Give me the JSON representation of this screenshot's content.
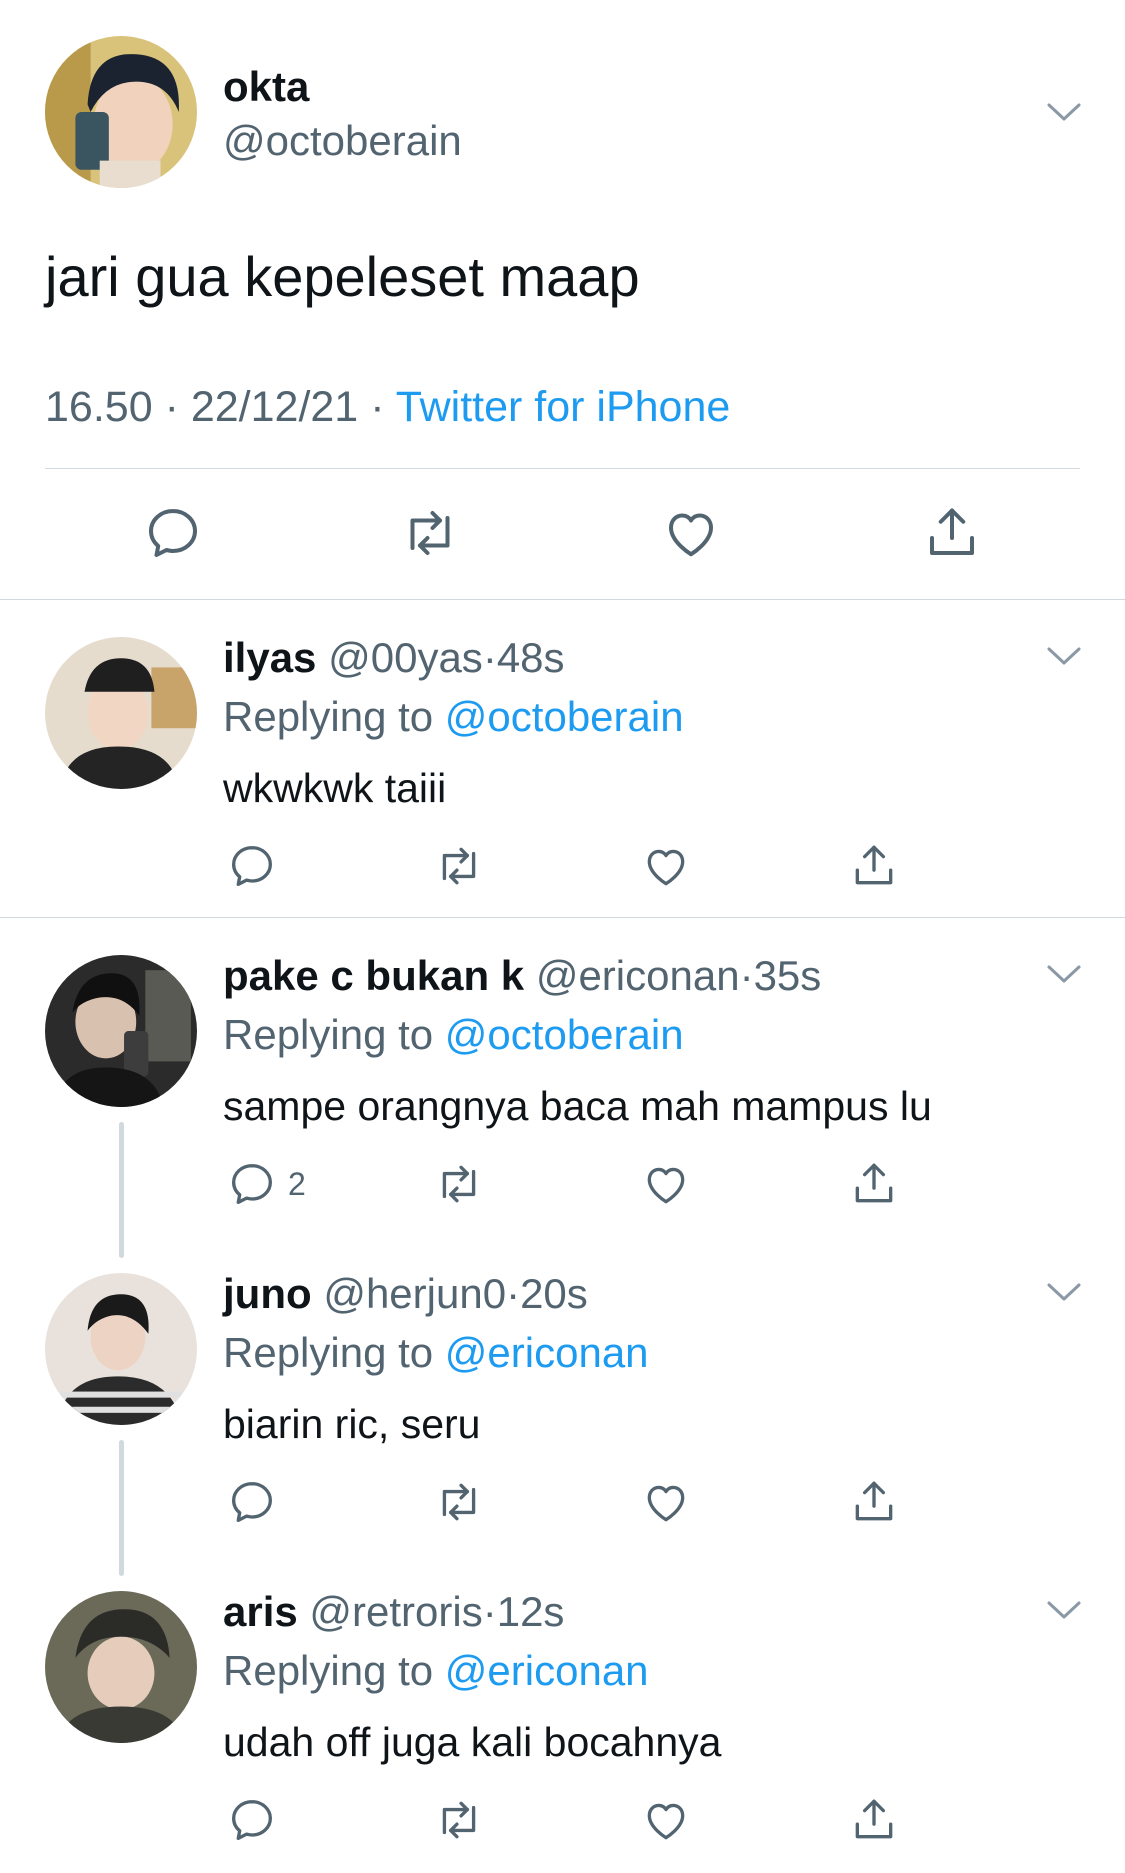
{
  "main_tweet": {
    "display_name": "okta",
    "handle": "@octoberain",
    "text": "jari gua kepeleset maap",
    "time": "16.50",
    "date": "22/12/21",
    "sep": "·",
    "source": "Twitter for iPhone"
  },
  "replies": [
    {
      "display_name": "ilyas",
      "handle": "@00yas",
      "sep": "·",
      "time": "48s",
      "replying_prefix": "Replying to",
      "replying_to": "@octoberain",
      "text": "wkwkwk taiii",
      "reply_count": ""
    },
    {
      "display_name": "pake c bukan k",
      "handle": "@ericonan",
      "sep": "·",
      "time": "35s",
      "replying_prefix": "Replying to",
      "replying_to": "@octoberain",
      "text": "sampe orangnya baca mah mampus lu",
      "reply_count": "2"
    },
    {
      "display_name": "juno",
      "handle": "@herjun0",
      "sep": "·",
      "time": "20s",
      "replying_prefix": "Replying to",
      "replying_to": "@ericonan",
      "text": "biarin ric, seru",
      "reply_count": ""
    },
    {
      "display_name": "aris",
      "handle": "@retroris",
      "sep": "·",
      "time": "12s",
      "replying_prefix": "Replying to",
      "replying_to": "@ericonan",
      "text": "udah off juga kali bocahnya",
      "reply_count": ""
    }
  ],
  "icons": {
    "reply": "reply-icon",
    "retweet": "retweet-icon",
    "like": "heart-icon",
    "share": "share-icon",
    "menu": "chevron-down-icon"
  },
  "colors": {
    "link": "#1d9bf0",
    "muted": "#536471",
    "text": "#0f1419",
    "divider": "#cfd9de"
  }
}
